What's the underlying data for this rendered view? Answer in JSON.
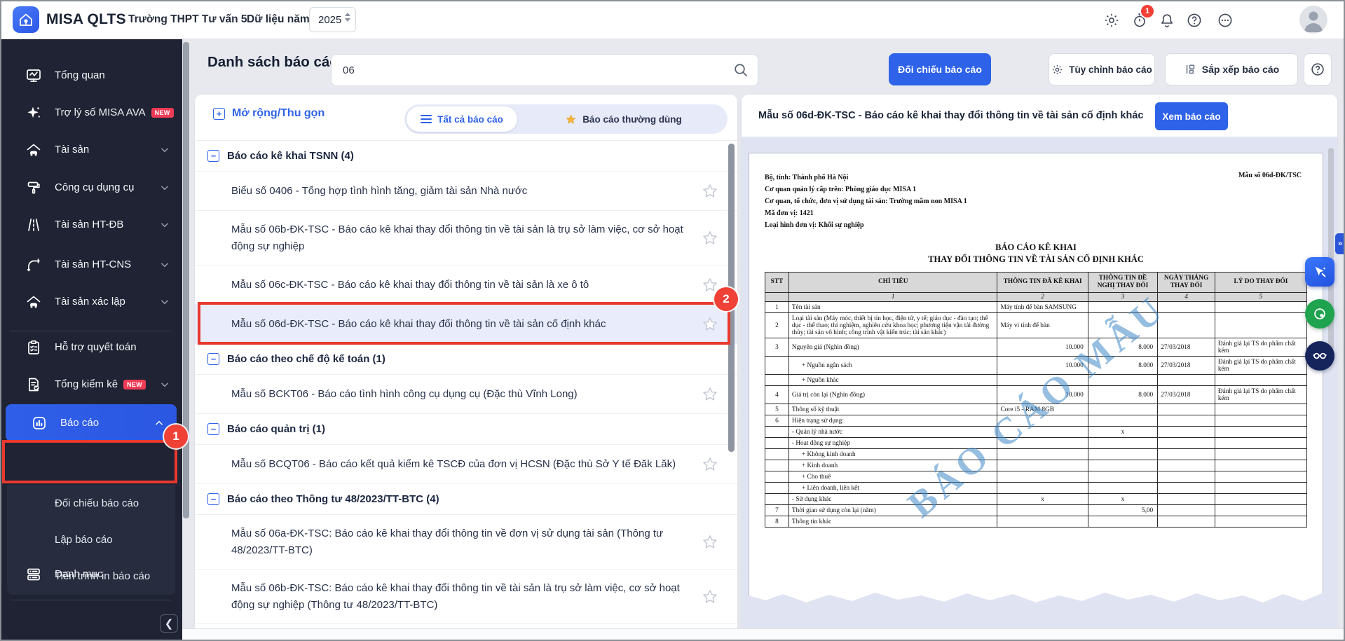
{
  "topbar": {
    "app_name": "MISA QLTS",
    "org_name": "Trường THPT Tư vấn 5",
    "year_label": "Dữ liệu năm",
    "year_value": "2025",
    "timer_badge": "1",
    "icons": [
      "gear-icon",
      "timer-icon",
      "bell-icon",
      "help-icon",
      "more-icon",
      "avatar"
    ]
  },
  "sidebar": {
    "items": [
      {
        "label": "Tổng quan",
        "icon": "overview-icon"
      },
      {
        "label": "Trợ lý số MISA AVA",
        "icon": "sparkle-icon",
        "badge": "NEW"
      },
      {
        "label": "Tài sản",
        "icon": "asset-icon",
        "chevron": "down"
      },
      {
        "label": "Công cụ dụng cụ",
        "icon": "tool-icon",
        "chevron": "down"
      },
      {
        "label": "Tài sản HT-ĐB",
        "icon": "road-icon",
        "chevron": "down"
      },
      {
        "label": "Tài sản HT-CNS",
        "icon": "pipe-icon",
        "chevron": "down"
      },
      {
        "label": "Tài sản xác lập",
        "icon": "asset-claim-icon",
        "chevron": "down",
        "divider_after": true
      },
      {
        "label": "Hỗ trợ quyết toán",
        "icon": "clipboard-icon"
      },
      {
        "label": "Tổng kiểm kê",
        "icon": "inventory-icon",
        "badge": "NEW",
        "chevron": "down"
      },
      {
        "label": "Báo cáo",
        "icon": "report-icon",
        "chevron": "up",
        "active": true,
        "children": [
          "Đối chiếu báo cáo",
          "Lập báo cáo",
          "Tiến trình in báo cáo"
        ]
      },
      {
        "label": "Danh mục",
        "icon": "category-icon"
      }
    ]
  },
  "header": {
    "title": "Danh sách báo cáo",
    "search_value": "06",
    "compare_button": "Đối chiếu báo cáo",
    "customize_button": "Tùy chỉnh báo cáo",
    "sort_button": "Sắp xếp báo cáo"
  },
  "report_list": {
    "expand_collapse_label": "Mở rộng/Thu gọn",
    "tabs": [
      {
        "label": "Tất cả báo cáo",
        "icon": "menu-icon",
        "active": true
      },
      {
        "label": "Báo cáo thường dùng",
        "icon": "star-icon",
        "active": false
      }
    ],
    "groups": [
      {
        "title": "Báo cáo kê khai TSNN (4)",
        "items": [
          {
            "label": "Biểu số 0406 - Tổng hợp tình hình tăng, giảm tài sản Nhà nước",
            "lines": 1
          },
          {
            "label": "Mẫu số 06b-ĐK-TSC - Báo cáo kê khai thay đổi thông tin về tài sản là trụ sở làm việc, cơ sở hoạt động sự nghiệp",
            "lines": 2
          },
          {
            "label": "Mẫu số 06c-ĐK-TSC - Báo cáo kê khai thay đổi thông tin về tài sản là xe ô tô",
            "lines": 1
          },
          {
            "label": "Mẫu số 06d-ĐK-TSC - Báo cáo kê khai thay đổi thông tin về tài sản cố định khác",
            "lines": 1,
            "selected": true
          }
        ]
      },
      {
        "title": "Báo cáo theo chế độ kế toán (1)",
        "items": [
          {
            "label": "Mẫu số BCKT06 - Báo cáo tình hình công cụ dụng cụ (Đặc thù Vĩnh Long)",
            "lines": 1
          }
        ]
      },
      {
        "title": "Báo cáo quản trị (1)",
        "items": [
          {
            "label": "Mẫu số BCQT06 - Báo cáo kết quả kiểm kê TSCĐ của đơn vị HCSN (Đặc thù Sở Y tế Đăk Lăk)",
            "lines": 1
          }
        ]
      },
      {
        "title": "Báo cáo theo Thông tư 48/2023/TT-BTC (4)",
        "items": [
          {
            "label": "Mẫu số 06a-ĐK-TSC: Báo cáo kê khai thay đổi thông tin về đơn vị sử dụng tài sản (Thông tư 48/2023/TT-BTC)",
            "lines": 2
          },
          {
            "label": "Mẫu số 06b-ĐK-TSC: Báo cáo kê khai thay đổi thông tin về tài sản là trụ sở làm việc, cơ sở hoạt động sự nghiệp (Thông tư 48/2023/TT-BTC)",
            "lines": 2
          }
        ]
      }
    ]
  },
  "preview": {
    "title": "Mẫu số 06d-ĐK-TSC - Báo cáo kê khai thay đổi thông tin về tài sản cố định khác",
    "view_button": "Xem báo cáo",
    "watermark": "BÁO CÁO MẪU",
    "document": {
      "org_lines": [
        "Bộ, tỉnh: Thành phố Hà Nội",
        "Cơ quan quản lý cấp trên: Phòng giáo dục MISA 1",
        "Cơ quan, tổ chức, đơn vị sử dụng tài sản: Trường mầm non MISA 1",
        "Mã đơn vị: 1421",
        "Loại hình đơn vị: Khối sự nghiệp"
      ],
      "form_number": "Mẫu số 06d-ĐK/TSC",
      "title_line1": "BÁO CÁO KÊ KHAI",
      "title_line2": "THAY ĐỔI THÔNG TIN VỀ TÀI SẢN CỐ ĐỊNH KHÁC",
      "columns": [
        "STT",
        "CHỈ TIÊU",
        "THÔNG TIN ĐÃ KÊ KHAI",
        "THÔNG TIN ĐỀ NGHỊ THAY ĐỔI",
        "NGÀY THÁNG THAY ĐỔI",
        "LÝ DO THAY ĐỔI"
      ],
      "column_numbers": [
        "",
        "1",
        "2",
        "3",
        "4",
        "5"
      ],
      "rows": [
        {
          "stt": "1",
          "label": "Tên tài sản",
          "declared": "Máy tính để bàn SAMSUNG",
          "proposed": "",
          "date": "",
          "reason": "",
          "indent": 0
        },
        {
          "stt": "2",
          "label": "Loại tài sản (Máy móc, thiết bị tin học, điện tử, y tế; giáo dục - đào tạo; thể dục - thể thao; thí nghiệm, nghiên cứu khoa học; phương tiện vận tải đường thủy; tài sản vô hình; công trình vật kiến trúc; tài sản khác)",
          "declared": "Máy vi tính để bàn",
          "proposed": "",
          "date": "",
          "reason": "",
          "indent": 0
        },
        {
          "stt": "3",
          "label": "Nguyên giá (Nghìn đồng)",
          "declared": "10.000",
          "proposed": "8.000",
          "date": "27/03/2018",
          "reason": "Đánh giá lại TS do phẩm chất kém",
          "indent": 0
        },
        {
          "stt": "",
          "label": "+ Nguồn ngân sách",
          "declared": "10.000",
          "proposed": "8.000",
          "date": "27/03/2018",
          "reason": "Đánh giá lại TS do phẩm chất kém",
          "indent": 1
        },
        {
          "stt": "",
          "label": "+ Nguồn khác",
          "declared": "",
          "proposed": "",
          "date": "",
          "reason": "",
          "indent": 1
        },
        {
          "stt": "4",
          "label": "Giá trị còn lại (Nghìn đồng)",
          "declared": "10.000",
          "proposed": "8.000",
          "date": "27/03/2018",
          "reason": "Đánh giá lại TS do phẩm chất kém",
          "indent": 0
        },
        {
          "stt": "5",
          "label": "Thông số kỹ thuật",
          "declared": "Core i5 - RAM 8GB",
          "proposed": "",
          "date": "",
          "reason": "",
          "indent": 0
        },
        {
          "stt": "6",
          "label": "Hiện trạng sử dụng:",
          "declared": "",
          "proposed": "",
          "date": "",
          "reason": "",
          "indent": 0
        },
        {
          "stt": "",
          "label": "- Quản lý nhà nước",
          "declared": "",
          "proposed": "x",
          "date": "",
          "reason": "",
          "indent": 0
        },
        {
          "stt": "",
          "label": "- Hoạt động sự nghiệp",
          "declared": "",
          "proposed": "",
          "date": "",
          "reason": "",
          "indent": 0
        },
        {
          "stt": "",
          "label": "+ Không kinh doanh",
          "declared": "",
          "proposed": "",
          "date": "",
          "reason": "",
          "indent": 1
        },
        {
          "stt": "",
          "label": "+ Kinh doanh",
          "declared": "",
          "proposed": "",
          "date": "",
          "reason": "",
          "indent": 1
        },
        {
          "stt": "",
          "label": "+ Cho thuê",
          "declared": "",
          "proposed": "",
          "date": "",
          "reason": "",
          "indent": 1
        },
        {
          "stt": "",
          "label": "+ Liên doanh, liên kết",
          "declared": "",
          "proposed": "",
          "date": "",
          "reason": "",
          "indent": 1
        },
        {
          "stt": "",
          "label": "- Sử dụng khác",
          "declared": "x",
          "proposed": "x",
          "date": "",
          "reason": "",
          "indent": 0
        },
        {
          "stt": "7",
          "label": "Thời gian sử dụng còn lại (năm)",
          "declared": "",
          "proposed": "5,00",
          "date": "",
          "reason": "",
          "indent": 0
        },
        {
          "stt": "8",
          "label": "Thông tin khác",
          "declared": "",
          "proposed": "",
          "date": "",
          "reason": "",
          "indent": 0
        }
      ]
    }
  },
  "annotations": {
    "step1": "1",
    "step2": "2"
  },
  "colors": {
    "accent_blue": "#2e62e8",
    "sidebar_bg": "#1f2333",
    "annotation_red": "#e8392e",
    "selected_row": "#e9ecfa",
    "watermark_blue": "#4089c9"
  }
}
